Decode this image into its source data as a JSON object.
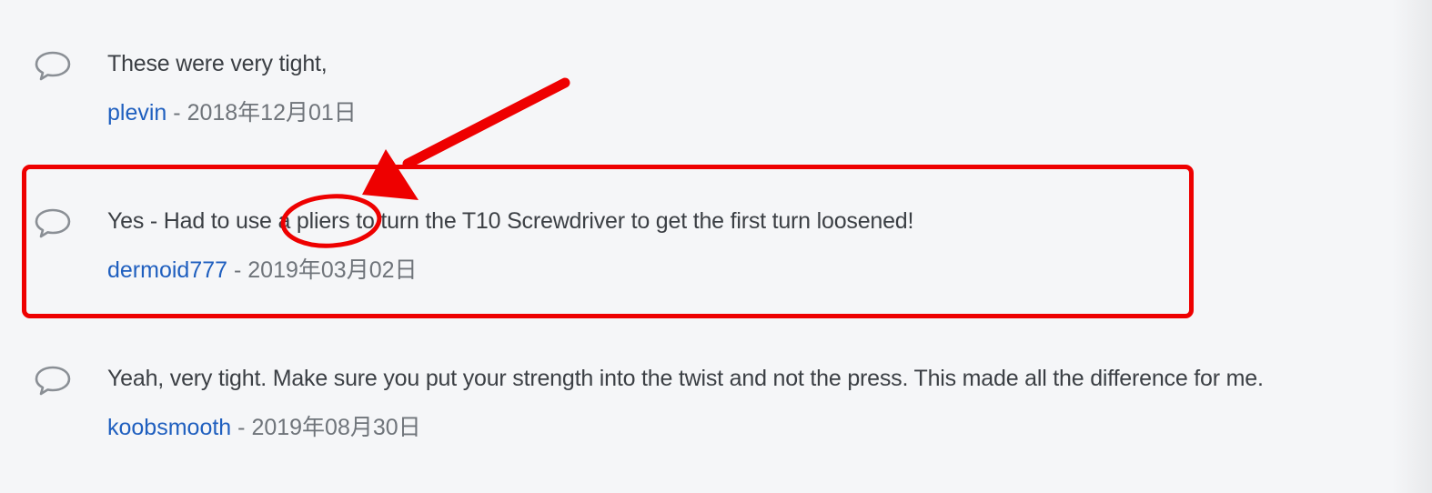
{
  "comments": [
    {
      "text": "These were very tight,",
      "author": "plevin",
      "separator": "-",
      "date": "2018年12月01日",
      "icon": "speech-bubble-icon"
    },
    {
      "text": "Yes - Had to use a pliers to turn the T10 Screwdriver to get the first turn loosened!",
      "author": "dermoid777",
      "separator": "-",
      "date": "2019年03月02日",
      "icon": "speech-bubble-icon"
    },
    {
      "text": "Yeah, very tight. Make sure you put your strength into the twist and not the press. This made all the difference for me.",
      "author": "koobsmooth",
      "separator": "-",
      "date": "2019年08月30日",
      "icon": "speech-bubble-icon"
    }
  ],
  "annotations": {
    "color": "#ee0000",
    "highlighted_word": "pliers",
    "shapes": [
      "highlight-box",
      "ellipse",
      "arrow"
    ]
  },
  "colors": {
    "background": "#f5f6f8",
    "text": "#3b3f44",
    "link": "#1f5fbf",
    "muted": "#6f747a",
    "icon": "#8a8f95"
  }
}
